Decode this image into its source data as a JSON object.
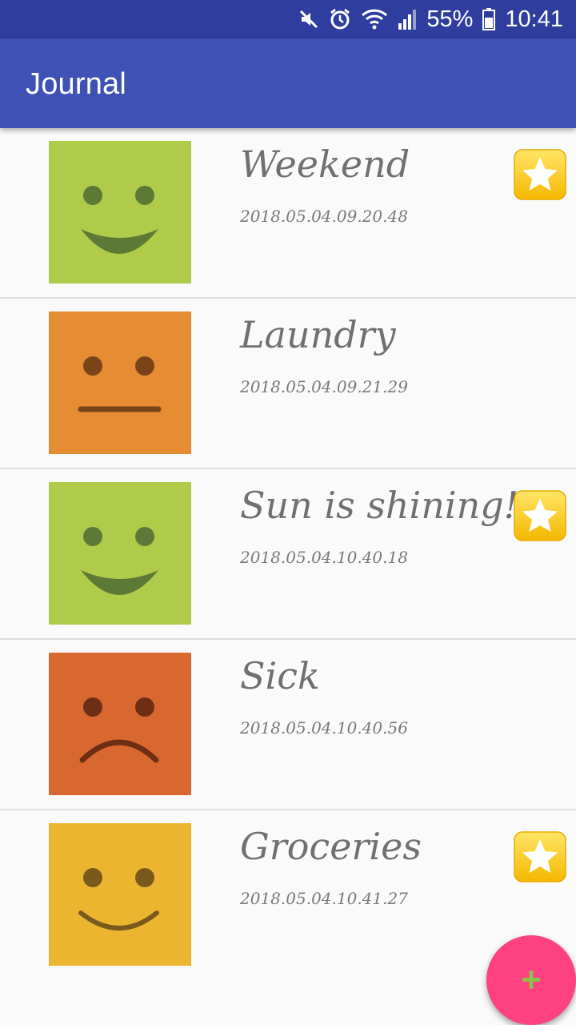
{
  "status_bar": {
    "battery_percent": "55%",
    "time": "10:41",
    "icons": [
      "mute-icon",
      "alarm-icon",
      "wifi-icon",
      "signal-icon",
      "battery-icon"
    ]
  },
  "app_bar": {
    "title": "Journal"
  },
  "entries": [
    {
      "title": "Weekend",
      "date": "2018.05.04.09.20.48",
      "mood": "happy",
      "color": "#b0cb4a",
      "starred": true
    },
    {
      "title": "Laundry",
      "date": "2018.05.04.09.21.29",
      "mood": "neutral",
      "color": "#e68c32",
      "starred": false
    },
    {
      "title": "Sun is shining!",
      "date": "2018.05.04.10.40.18",
      "mood": "happy",
      "color": "#b0cb4a",
      "starred": true
    },
    {
      "title": "Sick",
      "date": "2018.05.04.10.40.56",
      "mood": "sad",
      "color": "#d96830",
      "starred": false
    },
    {
      "title": "Groceries",
      "date": "2018.05.04.10.41.27",
      "mood": "smile",
      "color": "#ecb530",
      "starred": true
    }
  ],
  "fab": {
    "label": "+",
    "color": "#ff4081"
  }
}
